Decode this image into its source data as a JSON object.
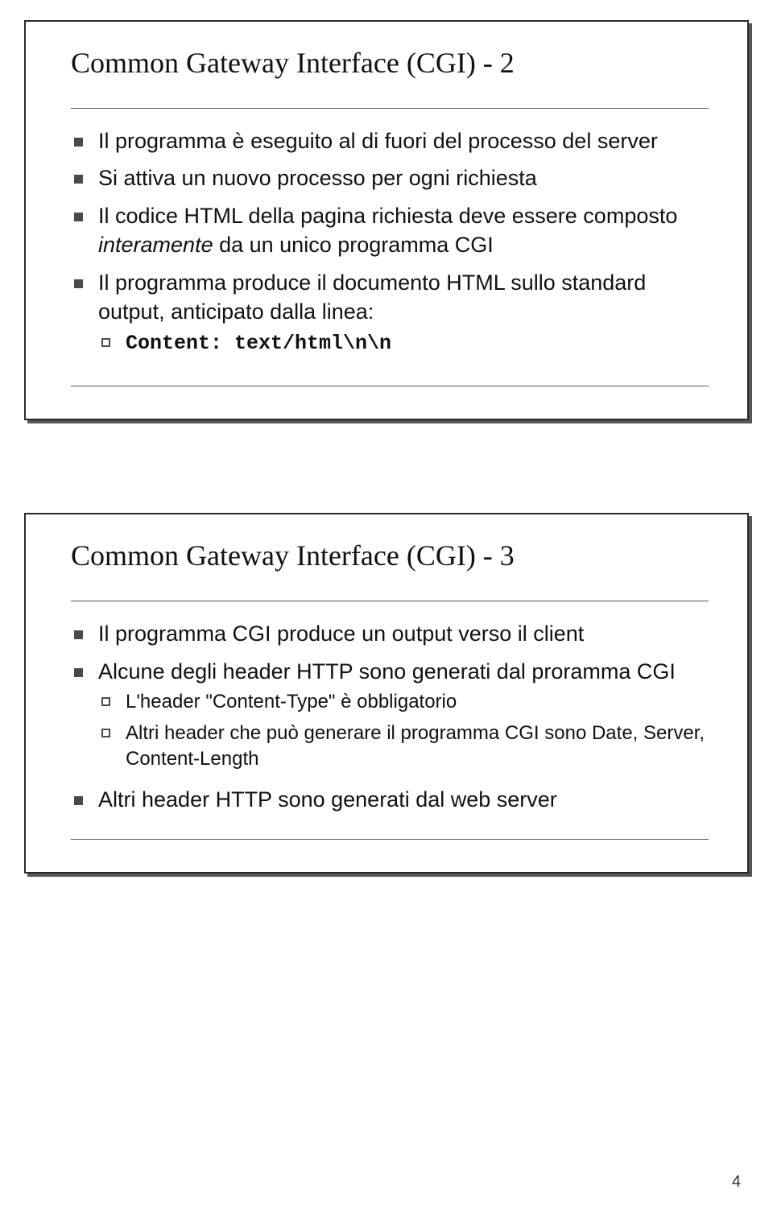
{
  "slide1": {
    "title": "Common Gateway Interface (CGI) - 2",
    "items": [
      {
        "text": "Il programma è eseguito al di fuori del processo del server"
      },
      {
        "text": "Si attiva un nuovo processo per ogni richiesta"
      },
      {
        "prefix": "Il codice HTML della pagina richiesta deve essere composto ",
        "italic": "interamente",
        "suffix": " da un unico programma CGI"
      },
      {
        "text": "Il programma produce il documento HTML sullo standard output, anticipato dalla linea:",
        "sub": [
          {
            "mono": "Content: text/html\\n\\n"
          }
        ]
      }
    ]
  },
  "slide2": {
    "title": "Common Gateway Interface (CGI) - 3",
    "items": [
      {
        "text": "Il programma CGI produce un output verso il client"
      },
      {
        "text": "Alcune degli header HTTP sono generati dal proramma CGI",
        "sub": [
          {
            "text": "L'header \"Content-Type\" è obbligatorio"
          },
          {
            "text": "Altri header che può generare il programma CGI sono Date, Server, Content-Length"
          }
        ]
      },
      {
        "text": "Altri header HTTP sono generati dal web server"
      }
    ]
  },
  "page_number": "4"
}
